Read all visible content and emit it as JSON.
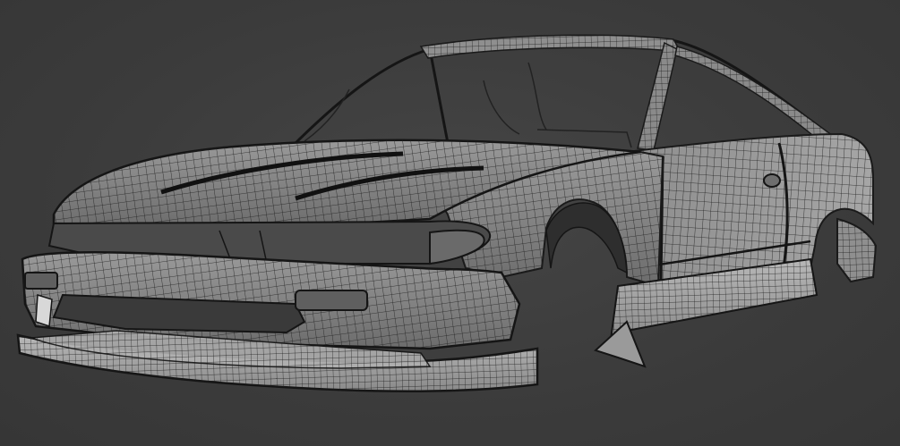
{
  "scene": {
    "subject": "wireframe-car-body-render",
    "colors": {
      "background": "#3d3d3d",
      "surface": "#8c8c8c",
      "surface_light": "#bdbdbd",
      "wire": "#1e1e1e",
      "glass": "#3a3a3a"
    }
  }
}
